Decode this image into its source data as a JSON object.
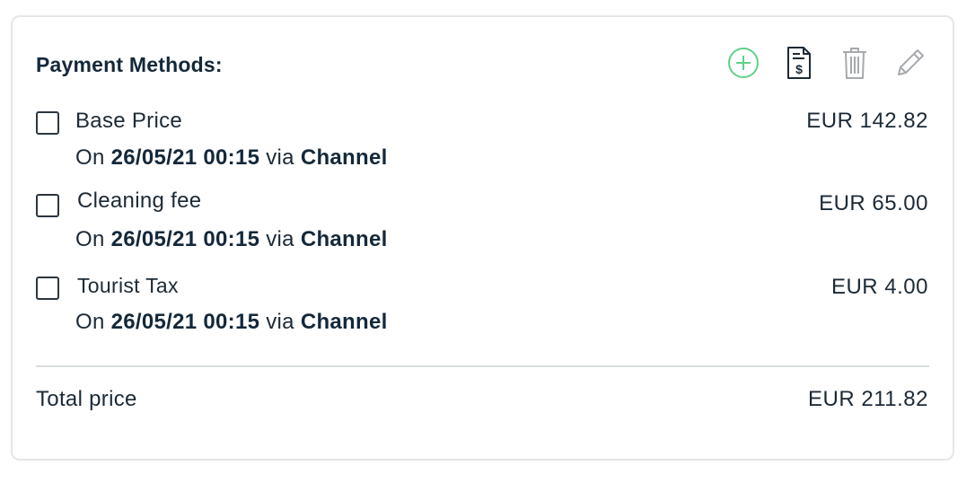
{
  "section": {
    "title": "Payment Methods:"
  },
  "toolbar": {
    "add_icon_color": "#5fd08a",
    "icons": [
      "add-circle-icon",
      "invoice-dollar-icon",
      "trash-icon",
      "pencil-icon"
    ]
  },
  "items": [
    {
      "name": "Base Price",
      "on": "On",
      "datetime": "26/05/21 00:15",
      "via": "via",
      "channel": "Channel",
      "amount": "EUR 142.82",
      "checked": false
    },
    {
      "name": "Cleaning fee",
      "on": "On",
      "datetime": "26/05/21 00:15",
      "via": "via",
      "channel": "Channel",
      "amount": "EUR 65.00",
      "checked": false
    },
    {
      "name": "Tourist Tax",
      "on": "On",
      "datetime": "26/05/21 00:15",
      "via": "via",
      "channel": "Channel",
      "amount": "EUR 4.00",
      "checked": false
    }
  ],
  "total": {
    "label": "Total price",
    "value": "EUR 211.82"
  }
}
